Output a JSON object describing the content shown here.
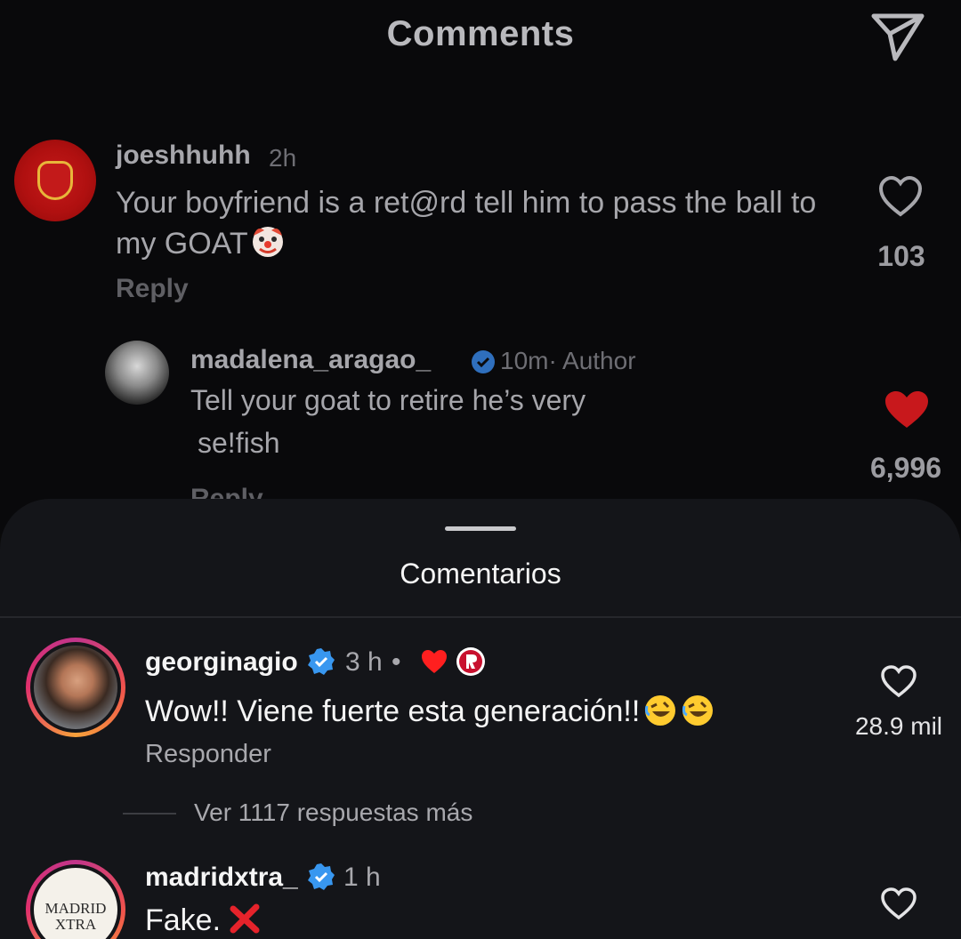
{
  "background_post": {
    "title": "Comments",
    "comment": {
      "username": "joeshhuhh",
      "time": "2h",
      "text": "Your boyfriend is a ret@rd tell him to pass the ball to my GOAT",
      "reply_label": "Reply",
      "likes": "103"
    },
    "reply": {
      "username": "madalena_aragao_",
      "meta": "10m· Author",
      "text_line1": "Tell your goat to retire he’s very",
      "text_line2": "se!fish",
      "likes": "6,996",
      "reply_label": "Reply"
    }
  },
  "sheet": {
    "title": "Comentarios",
    "comments": [
      {
        "username": "georginagio",
        "time": "3 h",
        "separator": "•",
        "text": "Wow!! Viene fuerte esta generación!!",
        "reply_label": "Responder",
        "likes": "28.9 mil"
      },
      {
        "username": "madridxtra_",
        "time": "1 h",
        "text": "Fake.",
        "avatar_text_line1": "MADRID",
        "avatar_text_line2": "XTRA"
      }
    ],
    "more_replies": "Ver 1117 respuestas más"
  },
  "colors": {
    "verified_blue": "#3897f0",
    "liked_red": "#ff1f1f",
    "sheet_bg": "#141519"
  }
}
